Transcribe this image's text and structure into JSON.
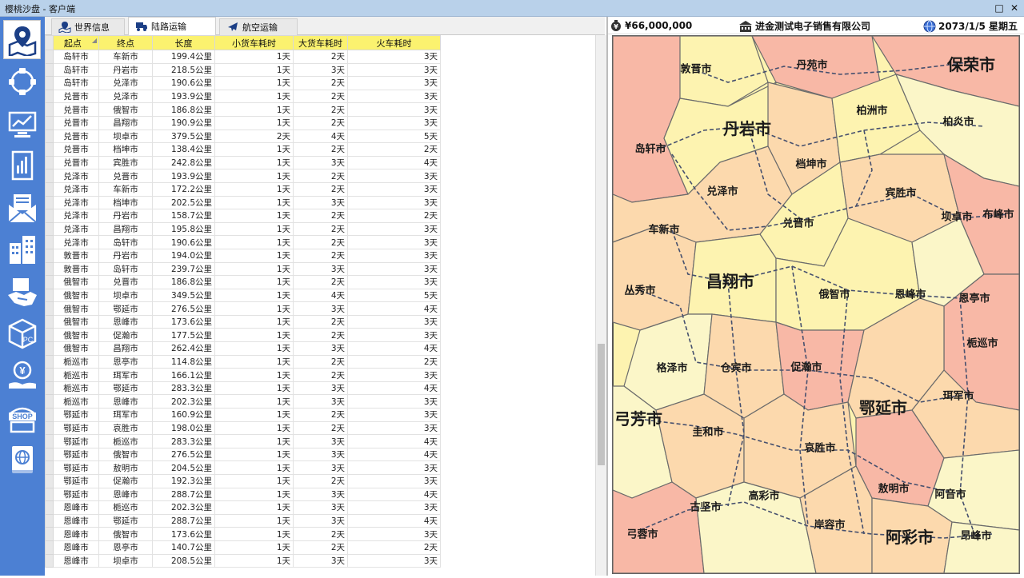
{
  "window": {
    "title": "樱桃沙盘 - 客户端"
  },
  "sidebar": {
    "items": [
      {
        "name": "map-pin-icon"
      },
      {
        "name": "logistics-icon"
      },
      {
        "name": "market-icon"
      },
      {
        "name": "report-icon"
      },
      {
        "name": "mail-icon"
      },
      {
        "name": "building-icon"
      },
      {
        "name": "handshake-icon"
      },
      {
        "name": "package-icon"
      },
      {
        "name": "finance-icon"
      },
      {
        "name": "shop-icon"
      },
      {
        "name": "globe-book-icon"
      }
    ]
  },
  "tabs": [
    {
      "label": "世界信息",
      "icon": "map-marker-icon"
    },
    {
      "label": "陆路运输",
      "icon": "truck-icon"
    },
    {
      "label": "航空运输",
      "icon": "airplane-icon"
    }
  ],
  "table": {
    "headers": [
      "起点",
      "终点",
      "长度",
      "小货车耗时",
      "大货车耗时",
      "火车耗时"
    ],
    "rows": [
      [
        "岛轩市",
        "车新市",
        "199.4公里",
        "1天",
        "2天",
        "3天"
      ],
      [
        "岛轩市",
        "丹岩市",
        "218.5公里",
        "1天",
        "3天",
        "3天"
      ],
      [
        "岛轩市",
        "兑泽市",
        "190.6公里",
        "1天",
        "2天",
        "3天"
      ],
      [
        "兑晋市",
        "兑泽市",
        "193.9公里",
        "1天",
        "2天",
        "3天"
      ],
      [
        "兑晋市",
        "俄智市",
        "186.8公里",
        "1天",
        "2天",
        "3天"
      ],
      [
        "兑晋市",
        "昌翔市",
        "190.9公里",
        "1天",
        "2天",
        "3天"
      ],
      [
        "兑晋市",
        "坝卓市",
        "379.5公里",
        "2天",
        "4天",
        "5天"
      ],
      [
        "兑晋市",
        "档坤市",
        "138.4公里",
        "1天",
        "2天",
        "2天"
      ],
      [
        "兑晋市",
        "宾胜市",
        "242.8公里",
        "1天",
        "3天",
        "4天"
      ],
      [
        "兑泽市",
        "兑晋市",
        "193.9公里",
        "1天",
        "2天",
        "3天"
      ],
      [
        "兑泽市",
        "车新市",
        "172.2公里",
        "1天",
        "2天",
        "3天"
      ],
      [
        "兑泽市",
        "档坤市",
        "202.5公里",
        "1天",
        "3天",
        "3天"
      ],
      [
        "兑泽市",
        "丹岩市",
        "158.7公里",
        "1天",
        "2天",
        "2天"
      ],
      [
        "兑泽市",
        "昌翔市",
        "195.8公里",
        "1天",
        "2天",
        "3天"
      ],
      [
        "兑泽市",
        "岛轩市",
        "190.6公里",
        "1天",
        "2天",
        "3天"
      ],
      [
        "敦晋市",
        "丹岩市",
        "194.0公里",
        "1天",
        "2天",
        "3天"
      ],
      [
        "敦晋市",
        "岛轩市",
        "239.7公里",
        "1天",
        "3天",
        "3天"
      ],
      [
        "俄智市",
        "兑晋市",
        "186.8公里",
        "1天",
        "2天",
        "3天"
      ],
      [
        "俄智市",
        "坝卓市",
        "349.5公里",
        "1天",
        "4天",
        "5天"
      ],
      [
        "俄智市",
        "鄂延市",
        "276.5公里",
        "1天",
        "3天",
        "4天"
      ],
      [
        "俄智市",
        "恩峰市",
        "173.6公里",
        "1天",
        "2天",
        "3天"
      ],
      [
        "俄智市",
        "促瀚市",
        "177.5公里",
        "1天",
        "2天",
        "3天"
      ],
      [
        "俄智市",
        "昌翔市",
        "262.4公里",
        "1天",
        "3天",
        "4天"
      ],
      [
        "栀巡市",
        "恩亭市",
        "114.8公里",
        "1天",
        "2天",
        "2天"
      ],
      [
        "栀巡市",
        "珥军市",
        "166.1公里",
        "1天",
        "2天",
        "3天"
      ],
      [
        "栀巡市",
        "鄂延市",
        "283.3公里",
        "1天",
        "3天",
        "4天"
      ],
      [
        "栀巡市",
        "恩峰市",
        "202.3公里",
        "1天",
        "3天",
        "3天"
      ],
      [
        "鄂延市",
        "珥军市",
        "160.9公里",
        "1天",
        "2天",
        "3天"
      ],
      [
        "鄂延市",
        "哀胜市",
        "198.0公里",
        "1天",
        "2天",
        "3天"
      ],
      [
        "鄂延市",
        "栀巡市",
        "283.3公里",
        "1天",
        "3天",
        "4天"
      ],
      [
        "鄂延市",
        "俄智市",
        "276.5公里",
        "1天",
        "3天",
        "4天"
      ],
      [
        "鄂延市",
        "敖明市",
        "204.5公里",
        "1天",
        "3天",
        "3天"
      ],
      [
        "鄂延市",
        "促瀚市",
        "192.3公里",
        "1天",
        "2天",
        "3天"
      ],
      [
        "鄂延市",
        "恩峰市",
        "288.7公里",
        "1天",
        "3天",
        "4天"
      ],
      [
        "恩峰市",
        "栀巡市",
        "202.3公里",
        "1天",
        "3天",
        "3天"
      ],
      [
        "恩峰市",
        "鄂延市",
        "288.7公里",
        "1天",
        "3天",
        "4天"
      ],
      [
        "恩峰市",
        "俄智市",
        "173.6公里",
        "1天",
        "2天",
        "3天"
      ],
      [
        "恩峰市",
        "恩亭市",
        "140.7公里",
        "1天",
        "2天",
        "2天"
      ],
      [
        "恩峰市",
        "坝卓市",
        "208.5公里",
        "1天",
        "3天",
        "3天"
      ]
    ]
  },
  "status": {
    "money": "¥66,000,000",
    "company": "进金测试电子销售有限公司",
    "date": "2073/1/5 星期五"
  },
  "map": {
    "cities": [
      {
        "name": "敦晋市",
        "size": "s"
      },
      {
        "name": "丹苑市",
        "size": "s"
      },
      {
        "name": "保荣市",
        "size": "l"
      },
      {
        "name": "柏洲市",
        "size": "s"
      },
      {
        "name": "柏炎市",
        "size": "s"
      },
      {
        "name": "丹岩市",
        "size": "l"
      },
      {
        "name": "岛轩市",
        "size": "s"
      },
      {
        "name": "档坤市",
        "size": "s"
      },
      {
        "name": "兑泽市",
        "size": "s"
      },
      {
        "name": "宾胜市",
        "size": "s"
      },
      {
        "name": "坝卓市",
        "size": "s"
      },
      {
        "name": "布峰市",
        "size": "s"
      },
      {
        "name": "车新市",
        "size": "s"
      },
      {
        "name": "兑晋市",
        "size": "s"
      },
      {
        "name": "昌翔市",
        "size": "l"
      },
      {
        "name": "丛秀市",
        "size": "s"
      },
      {
        "name": "俄智市",
        "size": "s"
      },
      {
        "name": "恩峰市",
        "size": "s"
      },
      {
        "name": "恩亭市",
        "size": "s"
      },
      {
        "name": "栀巡市",
        "size": "s"
      },
      {
        "name": "格泽市",
        "size": "s"
      },
      {
        "name": "仓宾市",
        "size": "s"
      },
      {
        "name": "促瀚市",
        "size": "s"
      },
      {
        "name": "珥军市",
        "size": "s"
      },
      {
        "name": "鄂延市",
        "size": "l"
      },
      {
        "name": "弓芳市",
        "size": "l"
      },
      {
        "name": "圭和市",
        "size": "s"
      },
      {
        "name": "哀胜市",
        "size": "s"
      },
      {
        "name": "敖明市",
        "size": "s"
      },
      {
        "name": "阿音市",
        "size": "s"
      },
      {
        "name": "古坚市",
        "size": "s"
      },
      {
        "name": "高彩市",
        "size": "s"
      },
      {
        "name": "弓蓉市",
        "size": "s"
      },
      {
        "name": "岸容市",
        "size": "s"
      },
      {
        "name": "阿彩市",
        "size": "l"
      },
      {
        "name": "昂峰市",
        "size": "s"
      }
    ]
  },
  "colors": {
    "sidebar": "#4c80d3",
    "header": "#fbf26f",
    "map_yellow": "#fdf3b0",
    "map_peach": "#fcd9ad",
    "map_salmon": "#f8b8a6",
    "map_pale": "#fbf6c8"
  }
}
